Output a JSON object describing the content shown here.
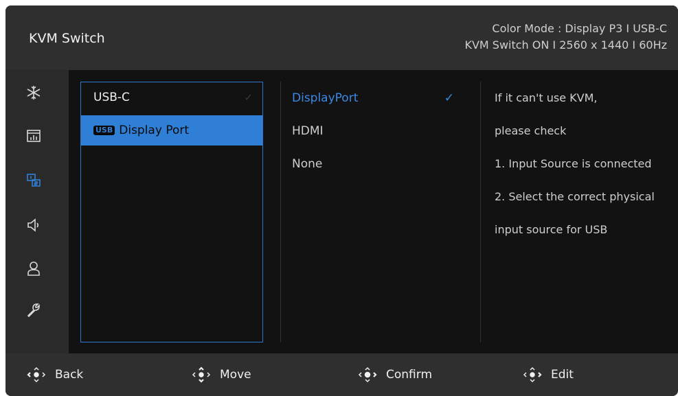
{
  "header": {
    "title": "KVM Switch",
    "status_line1": "Color Mode : Display P3  I  USB-C",
    "status_line2": "KVM Switch ON  I  2560 x 1440  I  60Hz"
  },
  "sidebar": {
    "items": [
      {
        "icon": "snowflake-icon",
        "active": false
      },
      {
        "icon": "picture-icon",
        "active": false
      },
      {
        "icon": "kvm-switch-icon",
        "active": true
      },
      {
        "icon": "speaker-icon",
        "active": false
      },
      {
        "icon": "user-icon",
        "active": false
      },
      {
        "icon": "wrench-icon",
        "active": false
      }
    ]
  },
  "column1": {
    "items": [
      {
        "label": "USB-C",
        "check": "✓",
        "selected": false
      },
      {
        "badge": "USB",
        "label": "Display Port",
        "selected": true
      }
    ]
  },
  "column2": {
    "items": [
      {
        "label": "DisplayPort",
        "active": true,
        "check": "✓"
      },
      {
        "label": "HDMI",
        "active": false
      },
      {
        "label": "None",
        "active": false
      }
    ]
  },
  "info": {
    "lines": [
      "If it can't use KVM,",
      "please check",
      "1. Input Source is connected",
      "2. Select the correct physical",
      "input source for USB"
    ]
  },
  "footer": {
    "back": "Back",
    "move": "Move",
    "confirm": "Confirm",
    "edit": "Edit"
  },
  "colors": {
    "accent": "#2f7fd7",
    "header_bg": "#2f2f2f",
    "sidebar_bg": "#2a2a2a",
    "main_bg": "#121212"
  }
}
